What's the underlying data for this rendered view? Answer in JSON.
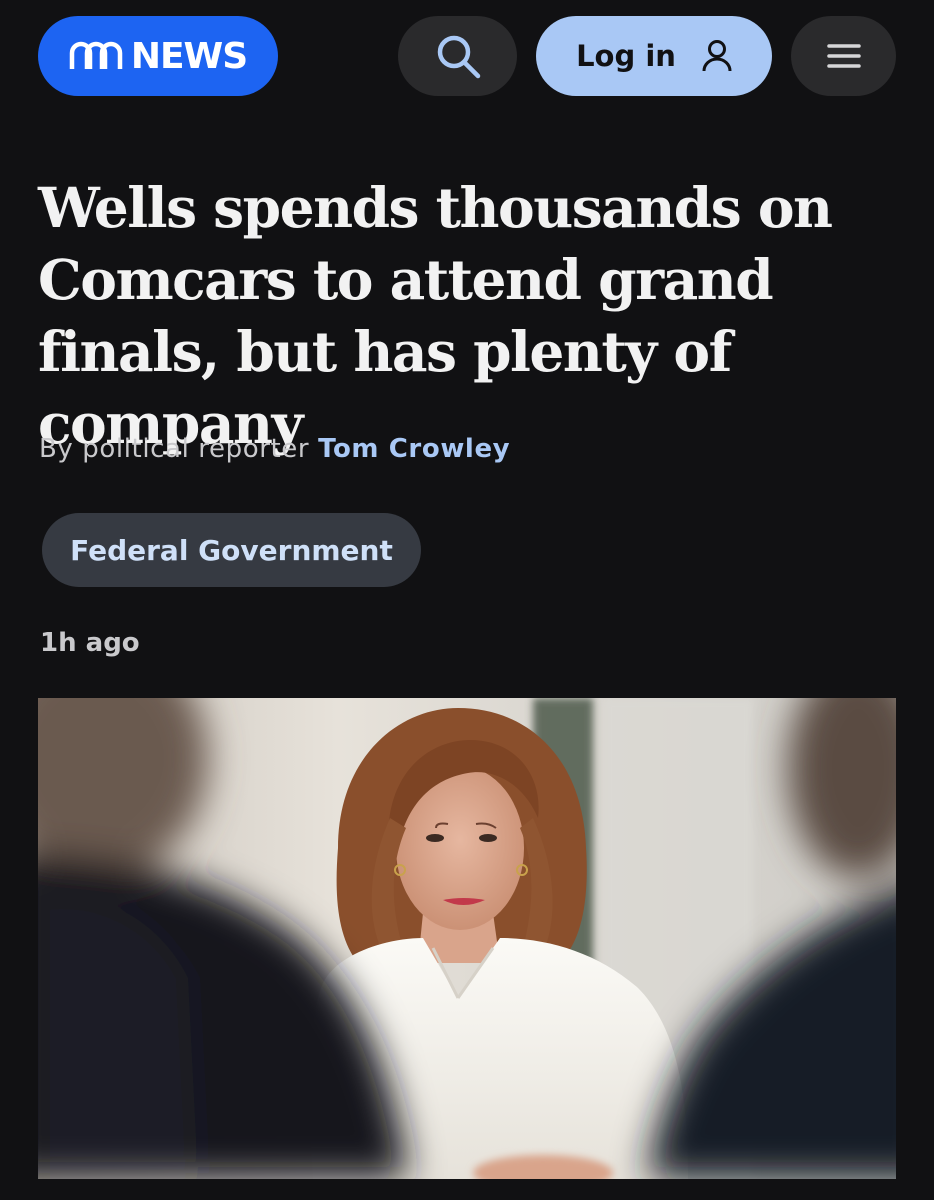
{
  "header": {
    "logo_text": "NEWS",
    "login_label": "Log in",
    "icons": {
      "search": "search-icon",
      "user": "user-icon",
      "menu": "hamburger-menu-icon"
    },
    "colors": {
      "brand": "#1d64f2",
      "login_bg": "#a9c8f5",
      "button_bg": "#2a2a2c"
    }
  },
  "article": {
    "headline": "Wells spends thousands on Comcars to attend grand finals, but has plenty of company",
    "byline_prefix": "By political reporter",
    "author": "Tom Crowley",
    "tag": "Federal Government",
    "timestamp": "1h ago"
  }
}
